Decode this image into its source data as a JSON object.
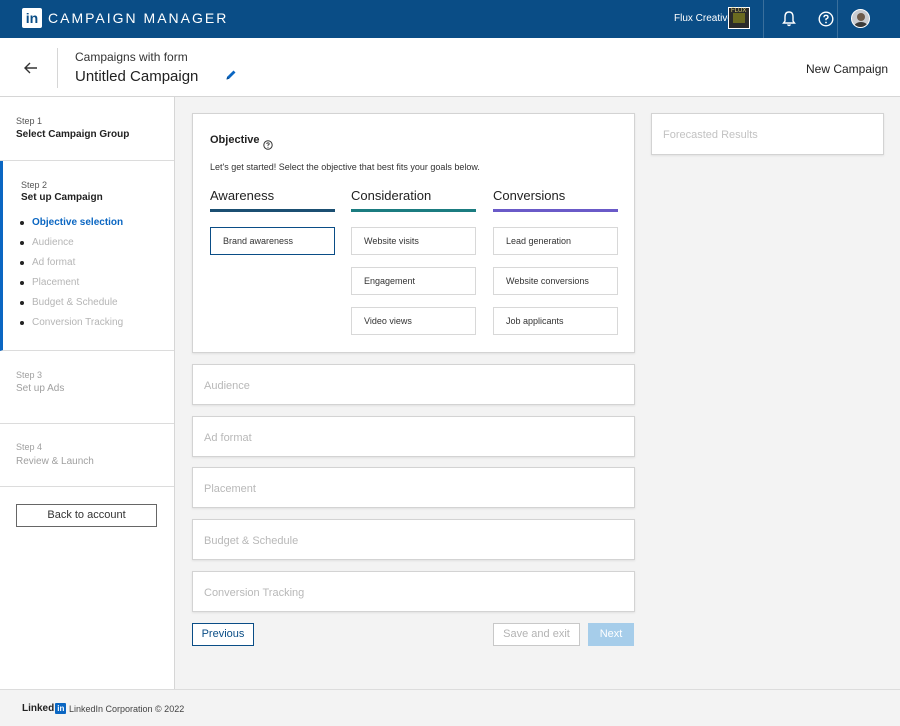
{
  "topbar": {
    "logo_letters": "in",
    "app_title": "CAMPAIGN MANAGER",
    "account_name": "Flux Creative",
    "account_badge_text": "FLUX"
  },
  "header": {
    "subtitle": "Campaigns with form",
    "title": "Untitled Campaign",
    "new_campaign": "New Campaign"
  },
  "sidebar": {
    "steps": [
      {
        "num": "Step 1",
        "name": "Select Campaign Group"
      },
      {
        "num": "Step 2",
        "name": "Set up Campaign"
      },
      {
        "num": "Step 3",
        "name": "Set up Ads"
      },
      {
        "num": "Step 4",
        "name": "Review & Launch"
      }
    ],
    "substeps": [
      "Objective selection",
      "Audience",
      "Ad format",
      "Placement",
      "Budget & Schedule",
      "Conversion Tracking"
    ],
    "back_button": "Back to account"
  },
  "objective": {
    "heading": "Objective",
    "description": "Let's get started! Select the objective that best fits your goals below.",
    "columns": [
      {
        "title": "Awareness",
        "color": "#1b4f72",
        "options": [
          "Brand awareness"
        ]
      },
      {
        "title": "Consideration",
        "color": "#1b7c80",
        "options": [
          "Website visits",
          "Engagement",
          "Video views"
        ]
      },
      {
        "title": "Conversions",
        "color": "#6a5ac8",
        "options": [
          "Lead generation",
          "Website conversions",
          "Job applicants"
        ]
      }
    ]
  },
  "sections": [
    "Audience",
    "Ad format",
    "Placement",
    "Budget & Schedule",
    "Conversion Tracking"
  ],
  "forecast": {
    "label": "Forecasted Results"
  },
  "actions": {
    "previous": "Previous",
    "save_exit": "Save and exit",
    "next": "Next"
  },
  "footer": {
    "brand_text": "Linked",
    "brand_in": "in",
    "copyright": "LinkedIn Corporation © 2022"
  },
  "colors": {
    "primary": "#0a4d86",
    "accent": "#0a66c2",
    "next_disabled": "#a6cdea"
  }
}
